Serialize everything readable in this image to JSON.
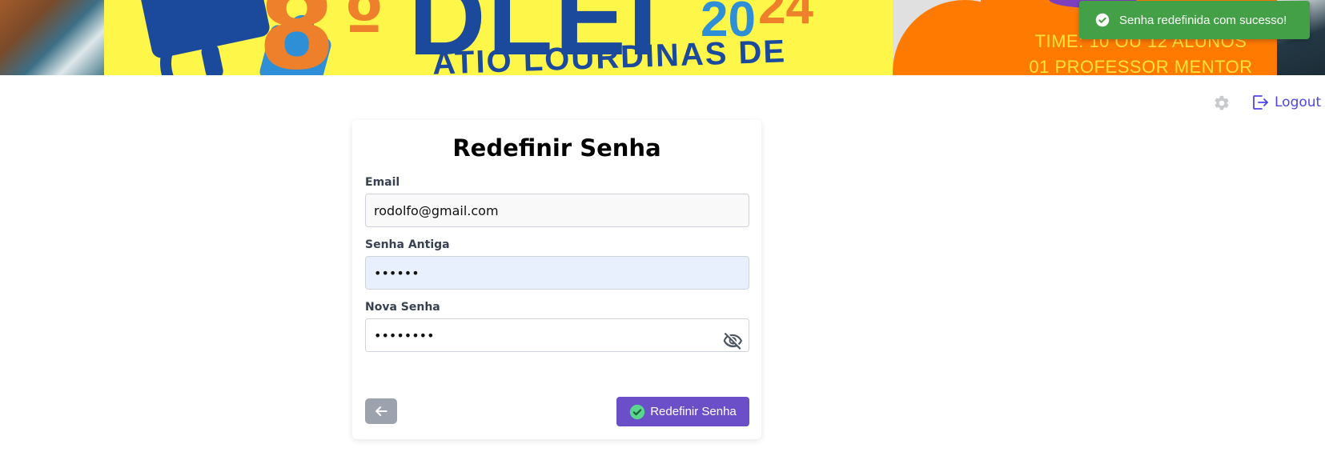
{
  "banner": {
    "event_number": "8",
    "event_ordinal": "º",
    "event_name": "DLEI",
    "year_part_a": "20",
    "year_part_b": "24",
    "subtitle": "ATIO LOURDINAS DE",
    "info_lines": [
      "TIME: 10 OU 12 ALUNOS",
      "01 PROFESSOR MENTOR"
    ]
  },
  "toast": {
    "message": "Senha redefinida com sucesso!",
    "icon": "check-circle-icon",
    "color": "#43a047"
  },
  "header": {
    "settings_icon": "gear-icon",
    "logout_label": "Logout",
    "logout_icon": "logout-icon",
    "accent_color": "#4f46e5"
  },
  "form": {
    "title": "Redefinir Senha",
    "email_label": "Email",
    "email_value": "rodolfo@gmail.com",
    "old_password_label": "Senha Antiga",
    "old_password_value": "••••••",
    "new_password_label": "Nova Senha",
    "new_password_value": "••••••••",
    "toggle_visibility_icon": "eye-off-icon",
    "back_icon": "arrow-left-icon",
    "submit_label": "Redefinir Senha",
    "submit_icon": "check-circle-icon",
    "submit_color": "#6a4fc8"
  }
}
